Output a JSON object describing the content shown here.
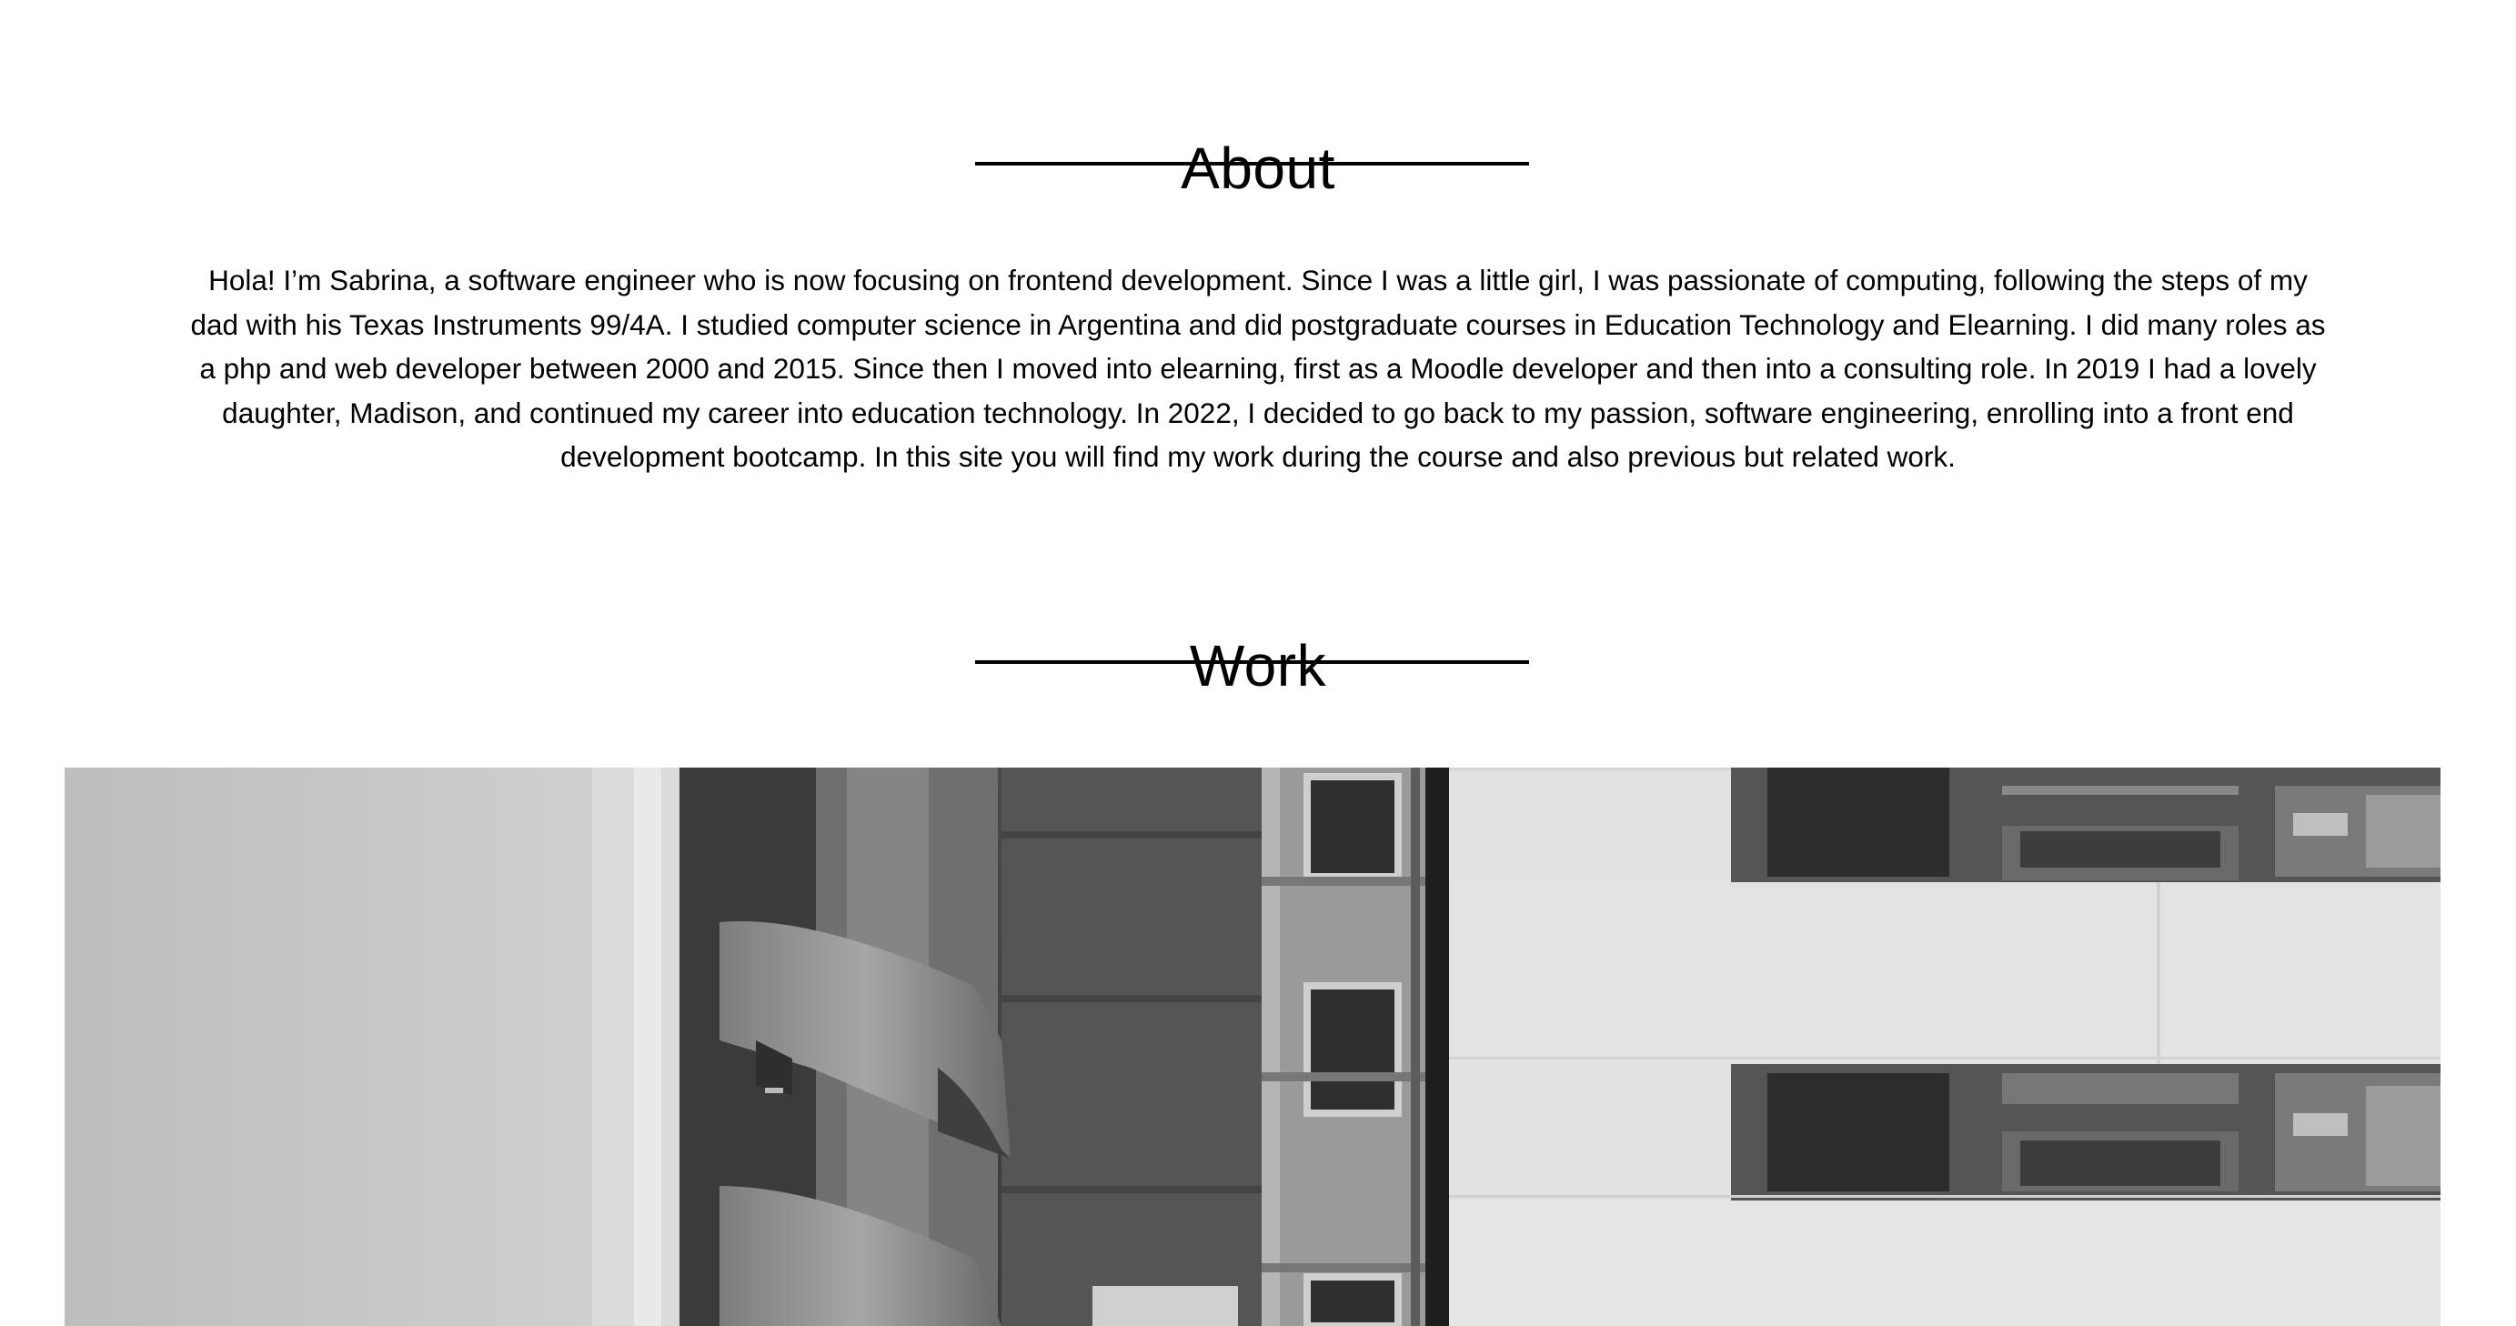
{
  "about": {
    "heading": "About",
    "paragraph": "Hola! I’m Sabrina, a software engineer who is now focusing on frontend development. Since I was a little girl, I was passionate of computing, following the steps of my dad with his Texas Instruments 99/4A. I studied computer science in Argentina and did postgraduate courses in Education Technology and Elearning. I did many roles as a php and web developer between 2000 and 2015. Since then I moved into elearning, first as a Moodle developer and then into a consulting role. In 2019 I had a lovely daughter, Madison, and continued my career into education technology. In 2022, I decided to go back to my passion, software engineering, enrolling into a front end development bootcamp. In this site you will find my work during the course and also previous but related work."
  },
  "work": {
    "heading": "Work",
    "image": {
      "subject": "black-and-white building facade with spiral staircase"
    }
  }
}
